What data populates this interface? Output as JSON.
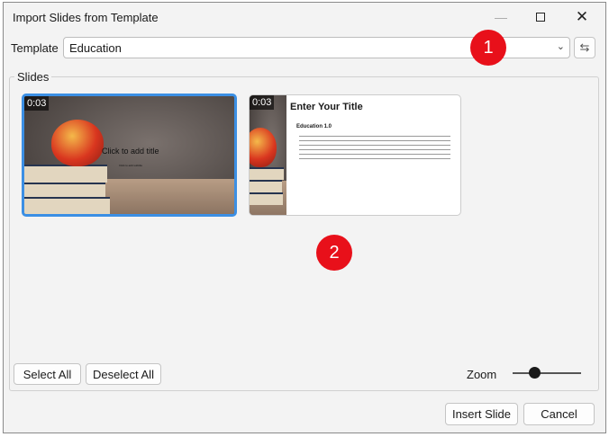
{
  "window": {
    "title": "Import Slides from Template",
    "controls": [
      "minimize",
      "maximize",
      "close"
    ]
  },
  "template": {
    "label": "Template",
    "value": "Education",
    "refresh_icon": "refresh-icon"
  },
  "slides_group": {
    "label": "Slides",
    "slides": [
      {
        "duration": "0:03",
        "title": "Click to add title",
        "subtitle": "Click to add subtitle",
        "selected": true
      },
      {
        "duration": "0:03",
        "title": "Enter Your Title",
        "heading": "Education 1.0",
        "selected": false
      }
    ]
  },
  "badges": [
    "1",
    "2"
  ],
  "buttons": {
    "select_all": "Select All",
    "deselect_all": "Deselect All",
    "insert": "Insert Slide",
    "cancel": "Cancel"
  },
  "zoom": {
    "label": "Zoom",
    "value_percent": 33
  },
  "colors": {
    "selection": "#3b8fe4",
    "badge": "#e8101a"
  }
}
